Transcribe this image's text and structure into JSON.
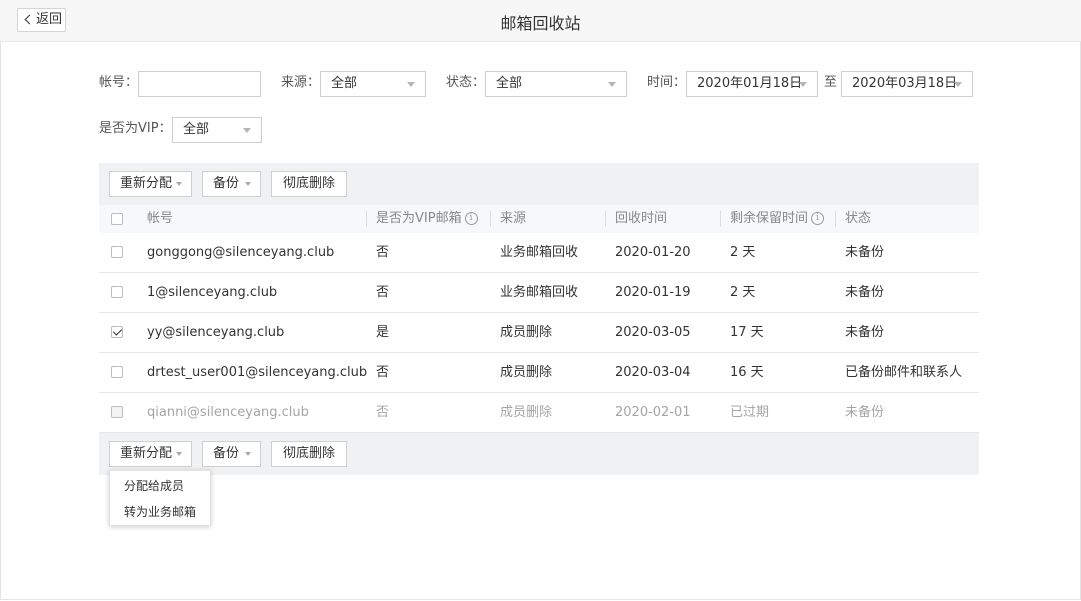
{
  "header": {
    "title": "邮箱回收站",
    "back_label": "返回"
  },
  "filters": {
    "account_label": "帐号：",
    "account_value": "",
    "source_label": "来源：",
    "source_value": "全部",
    "status_label": "状态：",
    "status_value": "全部",
    "time_label": "时间：",
    "date_from": "2020年01月18日",
    "date_to_sep": "至",
    "date_to": "2020年03月18日",
    "vip_label": "是否为VIP：",
    "vip_value": "全部"
  },
  "toolbar": {
    "reassign_label": "重新分配",
    "backup_label": "备份",
    "delete_label": "彻底删除"
  },
  "table": {
    "headers": {
      "account": "帐号",
      "is_vip": "是否为VIP邮箱",
      "source": "来源",
      "recycle_time": "回收时间",
      "remaining": "剩余保留时间",
      "status": "状态"
    },
    "info_glyph": "i",
    "rows": [
      {
        "checked": false,
        "expired": false,
        "account": "gonggong@silenceyang.club",
        "is_vip": "否",
        "source": "业务邮箱回收",
        "recycle_time": "2020-01-20",
        "remaining": "2 天",
        "status": "未备份"
      },
      {
        "checked": false,
        "expired": false,
        "account": "1@silenceyang.club",
        "is_vip": "否",
        "source": "业务邮箱回收",
        "recycle_time": "2020-01-19",
        "remaining": "2 天",
        "status": "未备份"
      },
      {
        "checked": true,
        "expired": false,
        "account": "yy@silenceyang.club",
        "is_vip": "是",
        "source": "成员删除",
        "recycle_time": "2020-03-05",
        "remaining": "17 天",
        "status": "未备份"
      },
      {
        "checked": false,
        "expired": false,
        "account": "drtest_user001@silenceyang.club",
        "is_vip": "否",
        "source": "成员删除",
        "recycle_time": "2020-03-04",
        "remaining": "16 天",
        "status": "已备份邮件和联系人"
      },
      {
        "checked": false,
        "expired": true,
        "account": "qianni@silenceyang.club",
        "is_vip": "否",
        "source": "成员删除",
        "recycle_time": "2020-02-01",
        "remaining": "已过期",
        "status": "未备份"
      }
    ]
  },
  "reassign_menu": {
    "items": [
      "分配给成员",
      "转为业务邮箱"
    ]
  },
  "colors": {
    "toolbar_bg": "#f0f1f3",
    "header_bg": "#f7f8f9",
    "muted_text": "#a5a5a5"
  }
}
